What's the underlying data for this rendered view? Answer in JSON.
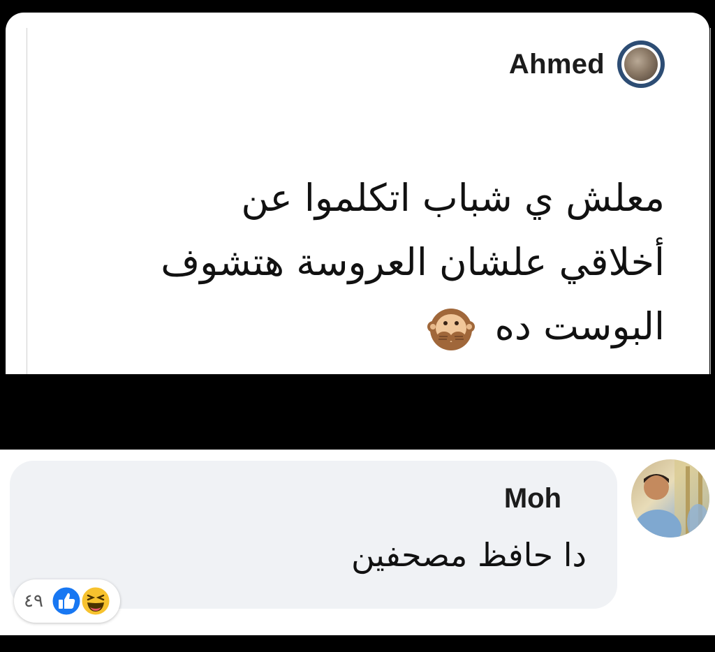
{
  "post": {
    "author": "Ahmed",
    "text_lines": [
      "معلش ي شباب اتكلموا عن",
      "أخلاقي علشان العروسة هتشوف",
      "البوست ده"
    ],
    "emoji": "speak-no-evil-monkey-icon"
  },
  "comment": {
    "author": "Moh",
    "text": "دا حافظ مصحفين",
    "reactions": {
      "count": "٤٩",
      "icons": [
        "like-icon",
        "haha-icon"
      ]
    }
  },
  "colors": {
    "background": "#000000",
    "card": "#ffffff",
    "bubble": "#f0f2f5",
    "like_blue": "#1877f2",
    "haha_yellow": "#f7c22e"
  }
}
